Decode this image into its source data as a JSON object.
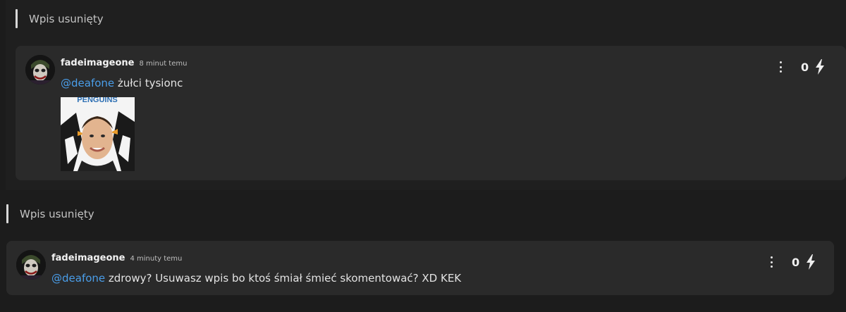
{
  "threads": [
    {
      "deleted_label": "Wpis usunięty",
      "comment": {
        "username": "fadeimageone",
        "time": "8 minut temu",
        "mention": "@deafone",
        "text": " żułci tysionc",
        "score": "0",
        "image_caption": "PENGUINS"
      }
    },
    {
      "deleted_label": "Wpis usunięty",
      "comment": {
        "username": "fadeimageone",
        "time": "4 minuty temu",
        "mention": "@deafone",
        "text": " zdrowy? Usuwasz wpis bo ktoś śmiał śmieć skomentować? XD KEK",
        "score": "0"
      }
    }
  ],
  "icons": {
    "menu": "more-vertical-icon",
    "vote": "lightning-bolt-icon",
    "avatar": "joker-avatar"
  },
  "colors": {
    "mention": "#4a9eea",
    "card": "#2a2a2a",
    "background": "#1c1c1c"
  }
}
